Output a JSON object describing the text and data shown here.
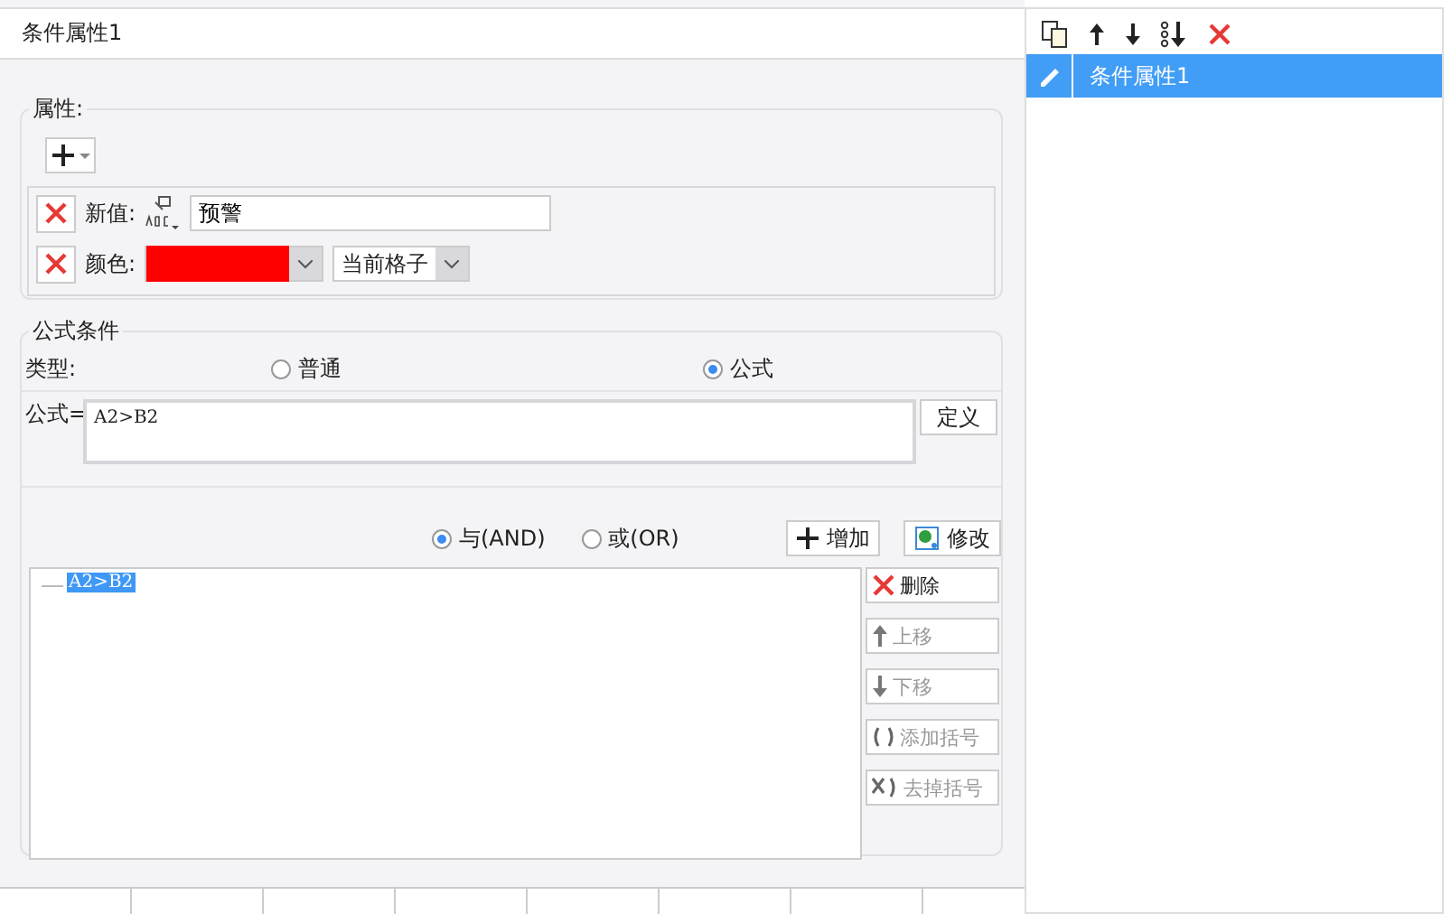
{
  "title": "条件属性1",
  "properties": {
    "legend": "属性:",
    "rows": [
      {
        "kind": "text",
        "label": "新值:",
        "value": "预警"
      },
      {
        "kind": "color",
        "label": "颜色:",
        "color": "#ff0000",
        "scope": "当前格子"
      }
    ]
  },
  "formula_condition": {
    "legend": "公式条件",
    "type_label": "类型:",
    "types": [
      {
        "label": "普通",
        "selected": false
      },
      {
        "label": "公式",
        "selected": true
      }
    ],
    "formula_label": "公式=",
    "formula": "A2>B2",
    "define_button": "定义",
    "logic": [
      {
        "label": "与(AND)",
        "selected": true
      },
      {
        "label": "或(OR)",
        "selected": false
      }
    ],
    "add_button": "增加",
    "edit_button": "修改",
    "conditions": [
      {
        "label": "A2>B2",
        "selected": true
      }
    ],
    "side_buttons": [
      {
        "kind": "delete",
        "label": "删除",
        "disabled": false
      },
      {
        "kind": "up",
        "label": "上移",
        "disabled": true
      },
      {
        "kind": "down",
        "label": "下移",
        "disabled": true
      },
      {
        "kind": "add_paren",
        "label": "添加括号",
        "disabled": true
      },
      {
        "kind": "remove_paren",
        "label": "去掉括号",
        "disabled": true
      }
    ]
  },
  "list": {
    "items": [
      {
        "label": "条件属性1",
        "selected": true
      }
    ]
  }
}
